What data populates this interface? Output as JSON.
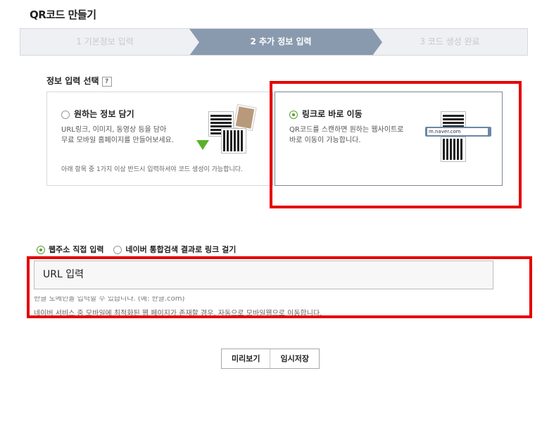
{
  "page": {
    "title": "QR코드 만들기"
  },
  "steps": [
    {
      "label": "1 기본정보 입력"
    },
    {
      "label": "2 추가 정보 입력"
    },
    {
      "label": "3 코드 생성 완료"
    }
  ],
  "info_select": {
    "label": "정보 입력 선택",
    "help": "?",
    "option1": {
      "title": "원하는 정보 담기",
      "desc1": "URL링크, 이미지, 동영상 등을 담아",
      "desc2": "무료 모바일 홈페이지를 만들어보세요.",
      "note": "아래 항목 중 1가지 이상 반드시 입력하셔야 코드 생성이 가능합니다."
    },
    "option2": {
      "title": "링크로 바로 이동",
      "desc1": "QR코드를 스캔하면 원하는 웹사이트로",
      "desc2": "바로 이동이 가능합니다.",
      "url_sample": "m.naver.com"
    }
  },
  "url_options": {
    "direct": "웹주소 직접 입력",
    "search": "네이버 통합검색 결과로 링크 걸기"
  },
  "url_input": {
    "placeholder": "URL 입력"
  },
  "hints": {
    "line1": "한글 도메인을 입력할 수 있습니다. (예: 한글.com)",
    "line2": "네이버 서비스 중 모바일에 최적화된 웹 페이지가 존재할 경우, 자동으로 모바일웹으로 이동합니다."
  },
  "buttons": {
    "preview": "미리보기",
    "save": "임시저장"
  },
  "colors": {
    "highlight": "#e50000",
    "active_step": "#8a9aae",
    "radio_on": "#5a9e2f"
  }
}
